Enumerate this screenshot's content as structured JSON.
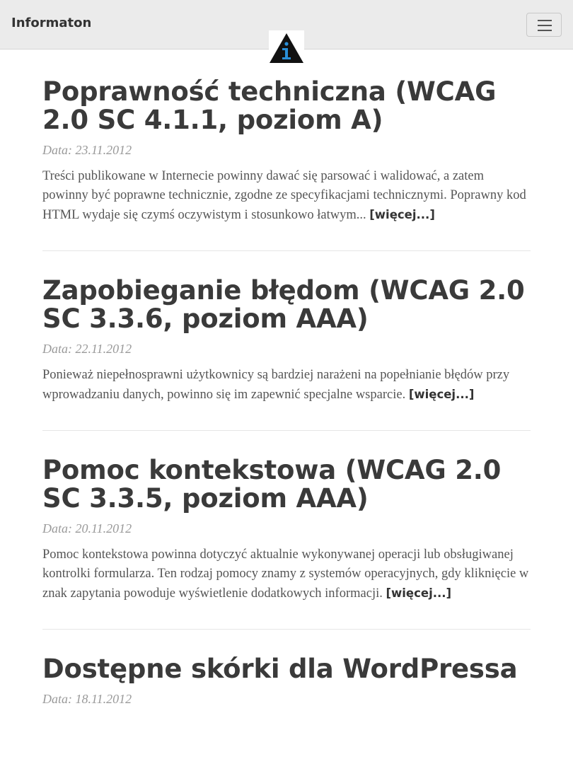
{
  "navbar": {
    "brand": "Informaton",
    "toggle_icon": "hamburger-menu-icon"
  },
  "logo": {
    "icon": "info-triangle-logo",
    "colors": {
      "triangle": "#111111",
      "symbol": "#2a8fd8"
    }
  },
  "posts": [
    {
      "title": "Poprawność techniczna (WCAG 2.0 SC 4.1.1, poziom A)",
      "date": "Data: 23.11.2012",
      "excerpt": "Treści publikowane w Internecie powinny dawać się parsować i walidować, a zatem powinny być poprawne technicznie, zgodne ze specyfikacjami technicznymi. Poprawny kod HTML wydaje się czymś oczywistym i stosunkowo łatwym...",
      "more": "[więcej...]"
    },
    {
      "title": "Zapobieganie błędom (WCAG 2.0 SC 3.3.6, poziom AAA)",
      "date": "Data: 22.11.2012",
      "excerpt": "Ponieważ niepełnosprawni użytkownicy są bardziej narażeni na popełnianie błędów przy wprowadzaniu danych, powinno się im zapewnić specjalne wsparcie.",
      "more": "[więcej...]"
    },
    {
      "title": "Pomoc kontekstowa (WCAG 2.0 SC 3.3.5, poziom AAA)",
      "date": "Data: 20.11.2012",
      "excerpt": "Pomoc kontekstowa powinna dotyczyć aktualnie wykonywanej operacji lub obsługiwanej kontrolki formularza. Ten rodzaj pomocy znamy z systemów operacyjnych, gdy kliknięcie w znak zapytania powoduje wyświetlenie dodatkowych informacji.",
      "more": "[więcej...]"
    },
    {
      "title": "Dostępne skórki dla WordPressa",
      "date": "Data: 18.11.2012",
      "excerpt": "",
      "more": ""
    }
  ]
}
